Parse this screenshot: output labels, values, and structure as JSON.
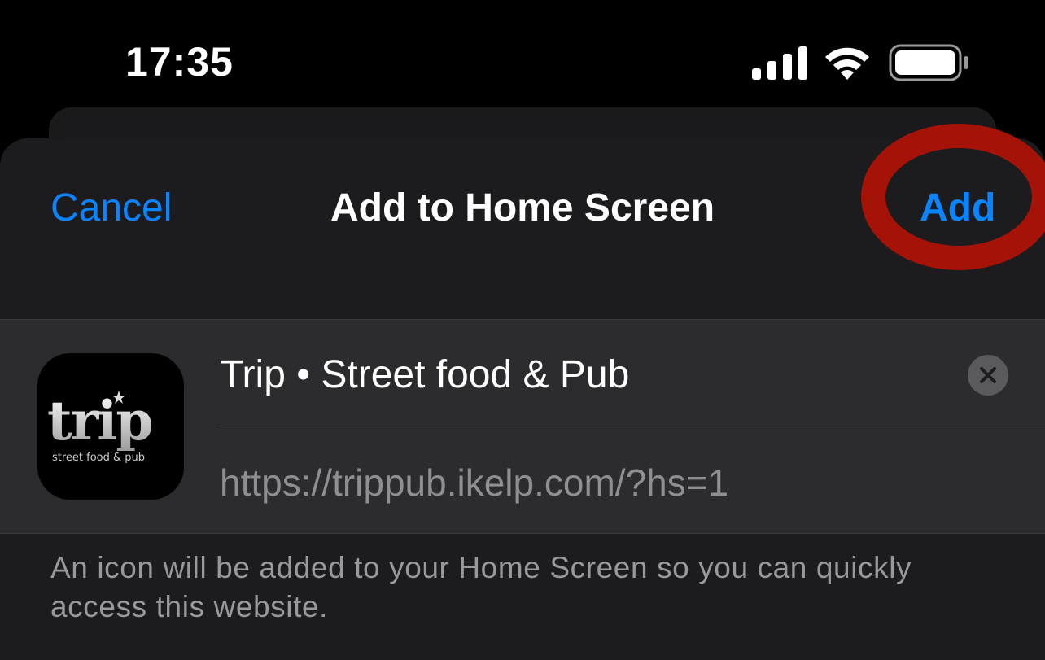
{
  "status_bar": {
    "time": "17:35",
    "icons": [
      "signal-icon",
      "wifi-icon",
      "battery-icon"
    ]
  },
  "sheet": {
    "cancel_label": "Cancel",
    "title": "Add to Home Screen",
    "add_label": "Add",
    "app_icon": {
      "name": "trip-logo",
      "logo_word": "trip",
      "logo_tagline": "street food & pub"
    },
    "name_value": "Trip • Street food & Pub",
    "url_value": "https://trippub.ikelp.com/?hs=1",
    "clear_icon": "close-icon",
    "footer_note": "An icon will be added to your Home Screen so you can quickly access this website."
  },
  "colors": {
    "accent": "#0a84ff",
    "annotation": "#a51207",
    "sheet_bg": "#1c1c1e",
    "group_bg": "#2c2c2e"
  }
}
